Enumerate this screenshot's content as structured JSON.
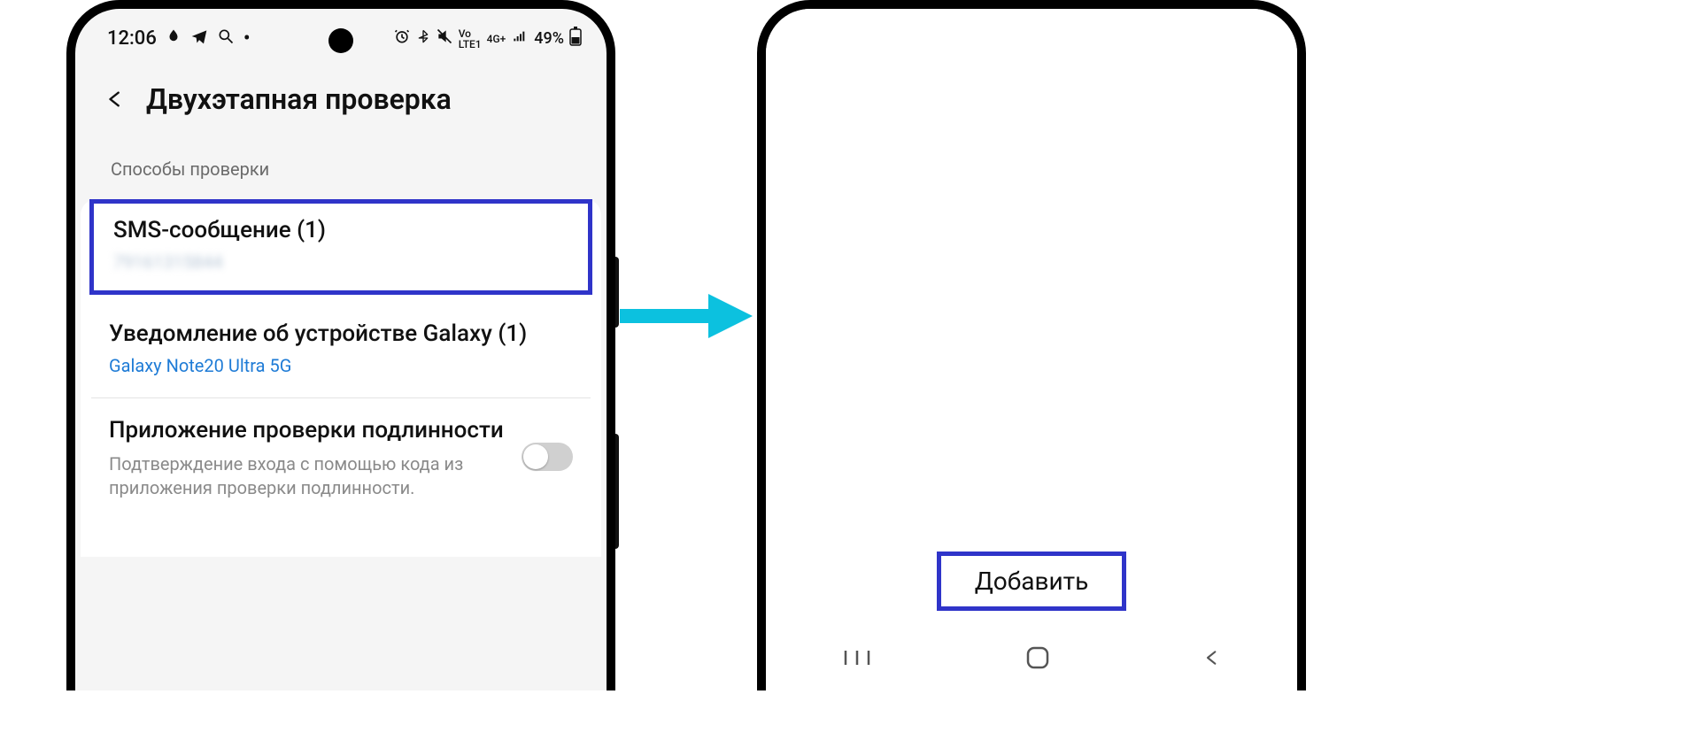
{
  "status": {
    "time": "12:06",
    "battery": "49%",
    "lte": "LTE1",
    "net": "4G+",
    "volte": "Vo"
  },
  "header": {
    "title": "Двухэтапная проверка"
  },
  "section": {
    "label": "Способы проверки"
  },
  "methods": {
    "sms": {
      "title": "SMS-сообщение (1)",
      "number": "79161315844"
    },
    "galaxy": {
      "title": "Уведомление об устройстве Galaxy (1)",
      "device": "Galaxy Note20 Ultra 5G"
    },
    "authapp": {
      "title": "Приложение проверки подлинности",
      "desc": "Подтверждение входа с помощью кода из приложения проверки подлинности.",
      "enabled": false
    }
  },
  "rightPhone": {
    "addLabel": "Добавить"
  },
  "colors": {
    "highlight": "#2f34c9",
    "link": "#1e7bd6",
    "arrow": "#0cc1df"
  }
}
